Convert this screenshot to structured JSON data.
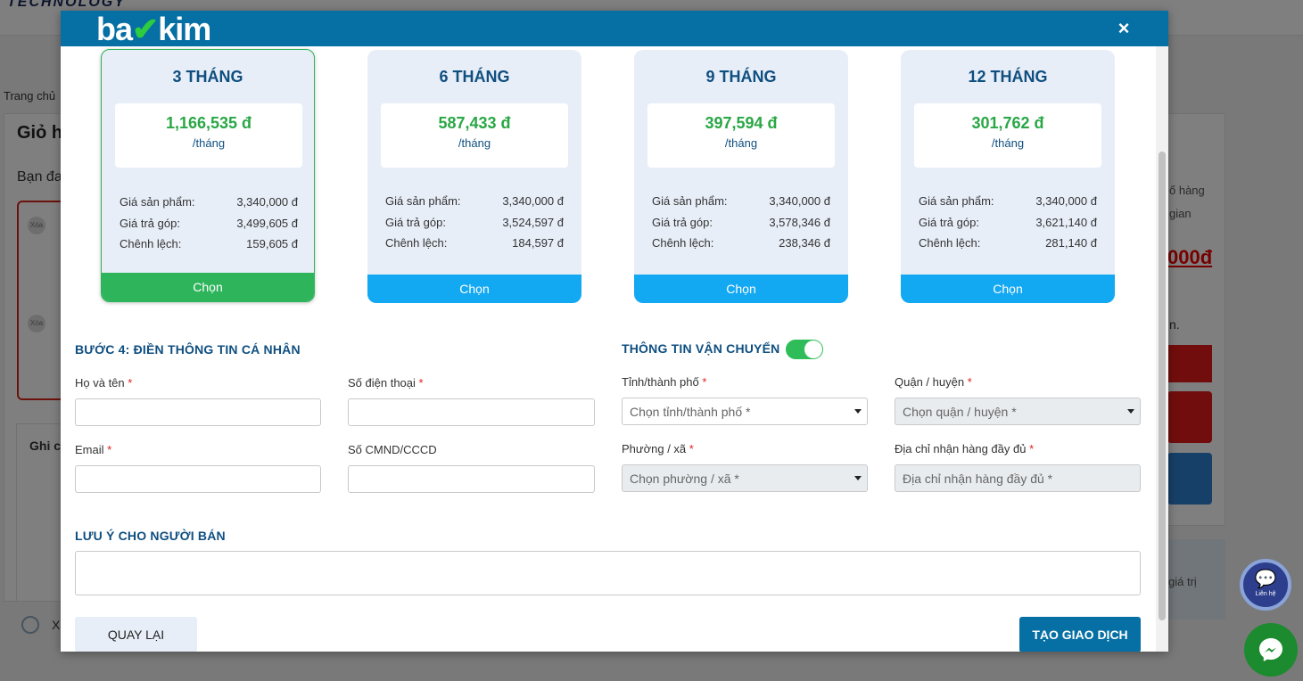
{
  "background": {
    "brand": "TECHNOLOGY",
    "breadcrumb": "Trang chủ",
    "cart_title": "Giỏ h",
    "cart_sub": "Bạn đa",
    "delete_label": "Xóa",
    "note_label": "Ghi c",
    "check_label": "X",
    "right_text_1": "ố hàng",
    "right_text_2": "gian",
    "right_price": "000đ",
    "right_dot": "n.",
    "right_text_3": "giá trị"
  },
  "modal": {
    "logo": {
      "left": "ba",
      "check": "✔",
      "right": "kim"
    },
    "close_label": "×"
  },
  "plans": [
    {
      "title": "3 THÁNG",
      "price": "1,166,535 đ",
      "unit": "/tháng",
      "product_label": "Giá sản phẩm:",
      "product_price": "3,340,000 đ",
      "installment_label": "Giá trả góp:",
      "installment_price": "3,499,605 đ",
      "diff_label": "Chênh lệch:",
      "diff": "159,605 đ",
      "button": "Chọn",
      "selected": true
    },
    {
      "title": "6 THÁNG",
      "price": "587,433 đ",
      "unit": "/tháng",
      "product_label": "Giá sản phẩm:",
      "product_price": "3,340,000 đ",
      "installment_label": "Giá trả góp:",
      "installment_price": "3,524,597 đ",
      "diff_label": "Chênh lệch:",
      "diff": "184,597 đ",
      "button": "Chọn",
      "selected": false
    },
    {
      "title": "9 THÁNG",
      "price": "397,594 đ",
      "unit": "/tháng",
      "product_label": "Giá sản phẩm:",
      "product_price": "3,340,000 đ",
      "installment_label": "Giá trả góp:",
      "installment_price": "3,578,346 đ",
      "diff_label": "Chênh lệch:",
      "diff": "238,346 đ",
      "button": "Chọn",
      "selected": false
    },
    {
      "title": "12 THÁNG",
      "price": "301,762 đ",
      "unit": "/tháng",
      "product_label": "Giá sản phẩm:",
      "product_price": "3,340,000 đ",
      "installment_label": "Giá trả góp:",
      "installment_price": "3,621,140 đ",
      "diff_label": "Chênh lệch:",
      "diff": "281,140 đ",
      "button": "Chọn",
      "selected": false
    }
  ],
  "personal": {
    "title": "BƯỚC 4: ĐIỀN THÔNG TIN CÁ NHÂN",
    "fullname_label": "Họ và tên",
    "phone_label": "Số điện thoại",
    "email_label": "Email",
    "id_label": "Số CMND/CCCD",
    "required_mark": "*"
  },
  "shipping": {
    "title": "THÔNG TIN VẬN CHUYỂN",
    "toggle_on": true,
    "province_label": "Tỉnh/thành phố",
    "province_placeholder": "Chọn tỉnh/thành phố *",
    "district_label": "Quận / huyện",
    "district_placeholder": "Chọn quận / huyện *",
    "ward_label": "Phường / xã",
    "ward_placeholder": "Chọn phường / xã *",
    "address_label": "Địa chỉ nhận hàng đầy đủ",
    "address_placeholder": "Địa chỉ nhận hàng đầy đủ *"
  },
  "note": {
    "title": "LƯU Ý CHO NGƯỜI BÁN"
  },
  "actions": {
    "back": "QUAY LẠI",
    "create": "TẠO GIAO DỊCH"
  },
  "widgets": {
    "contact_label": "Liên hệ"
  },
  "colors": {
    "header": "#066fa3",
    "selected": "#2eb55b",
    "choose": "#13a8f2",
    "price": "#29a745",
    "title": "#0f4f80"
  }
}
